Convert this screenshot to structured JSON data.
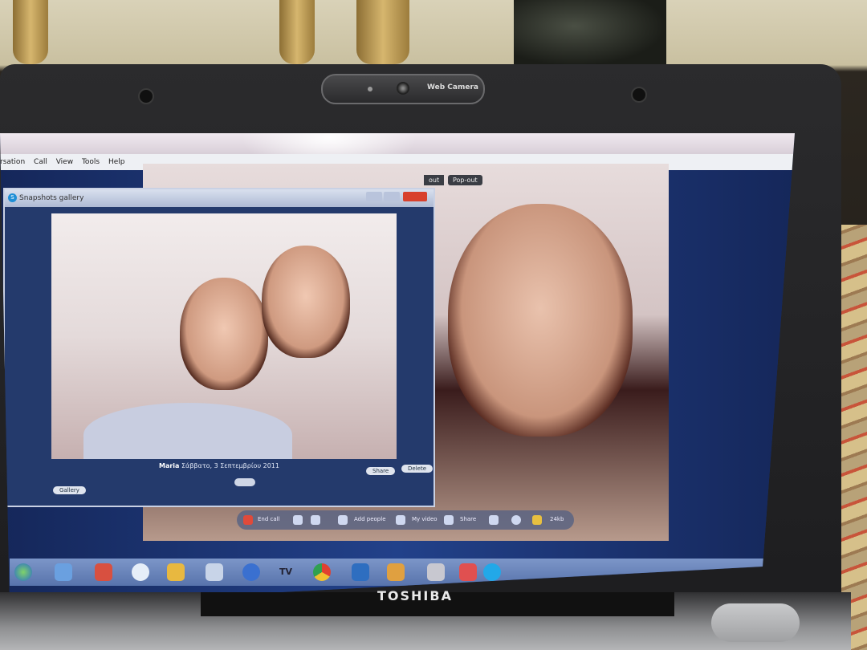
{
  "laptop": {
    "brand": "TOSHIBA",
    "webcam_label": "Web Camera"
  },
  "skype": {
    "menu": [
      "rsation",
      "Call",
      "View",
      "Tools",
      "Help"
    ],
    "popout_label": "Pop-out",
    "popout_partial": "out"
  },
  "gallery": {
    "title": "Snapshots gallery",
    "caption_name": "Maria",
    "caption_date": "Σάββατο, 3 Σεπτεμβρίου 2011",
    "share_label": "Share",
    "delete_label": "Delete",
    "gallery_label": "Gallery"
  },
  "callbar": {
    "end_call": "End call",
    "add_people": "Add people",
    "my_video": "My video",
    "share": "Share",
    "quality": "24kb"
  },
  "taskbar": {
    "tv_label": "TV"
  }
}
